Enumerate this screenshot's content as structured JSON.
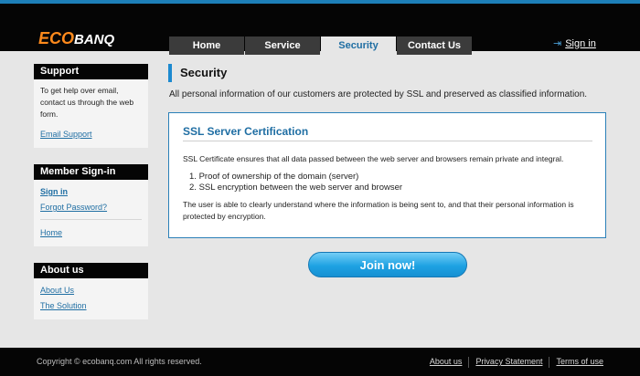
{
  "brand": {
    "eco": "ECO",
    "banq": "BANQ"
  },
  "nav": {
    "tabs": [
      {
        "label": "Home"
      },
      {
        "label": "Service"
      },
      {
        "label": "Security"
      },
      {
        "label": "Contact Us"
      }
    ],
    "active_tab": "Security",
    "signin_label": "Sign in",
    "signin_icon": "sign-in-arrow-icon"
  },
  "sidebar": {
    "support": {
      "title": "Support",
      "text": "To get help over email, contact us through the web form.",
      "link": "Email Support"
    },
    "member": {
      "title": "Member Sign-in",
      "signin": "Sign in",
      "forgot": "Forgot Password?",
      "home": "Home"
    },
    "about": {
      "title": "About us",
      "links": [
        "About Us",
        "The Solution"
      ]
    }
  },
  "main": {
    "title": "Security",
    "intro": "All personal information of our customers are protected by SSL and preserved as classified information.",
    "panel": {
      "title": "SSL Server Certification",
      "text": "SSL Certificate ensures that all data passed between the web server and browsers remain private and integral.",
      "items": [
        "Proof of ownership of the domain (server)",
        "SSL encryption between the web server and browser"
      ],
      "note": "The user is able to clearly understand where the information is being sent to, and that their personal information is protected by encryption."
    },
    "join_button": "Join now!"
  },
  "footer": {
    "copyright": "Copyright © ecobanq.com All rights reserved.",
    "links": [
      "About us",
      "Privacy Statement",
      "Terms of use"
    ]
  },
  "colors": {
    "accent": "#1d8ad0",
    "link": "#1f6ea3",
    "logo_orange": "#ff8a1c",
    "header_bg": "#050505"
  }
}
